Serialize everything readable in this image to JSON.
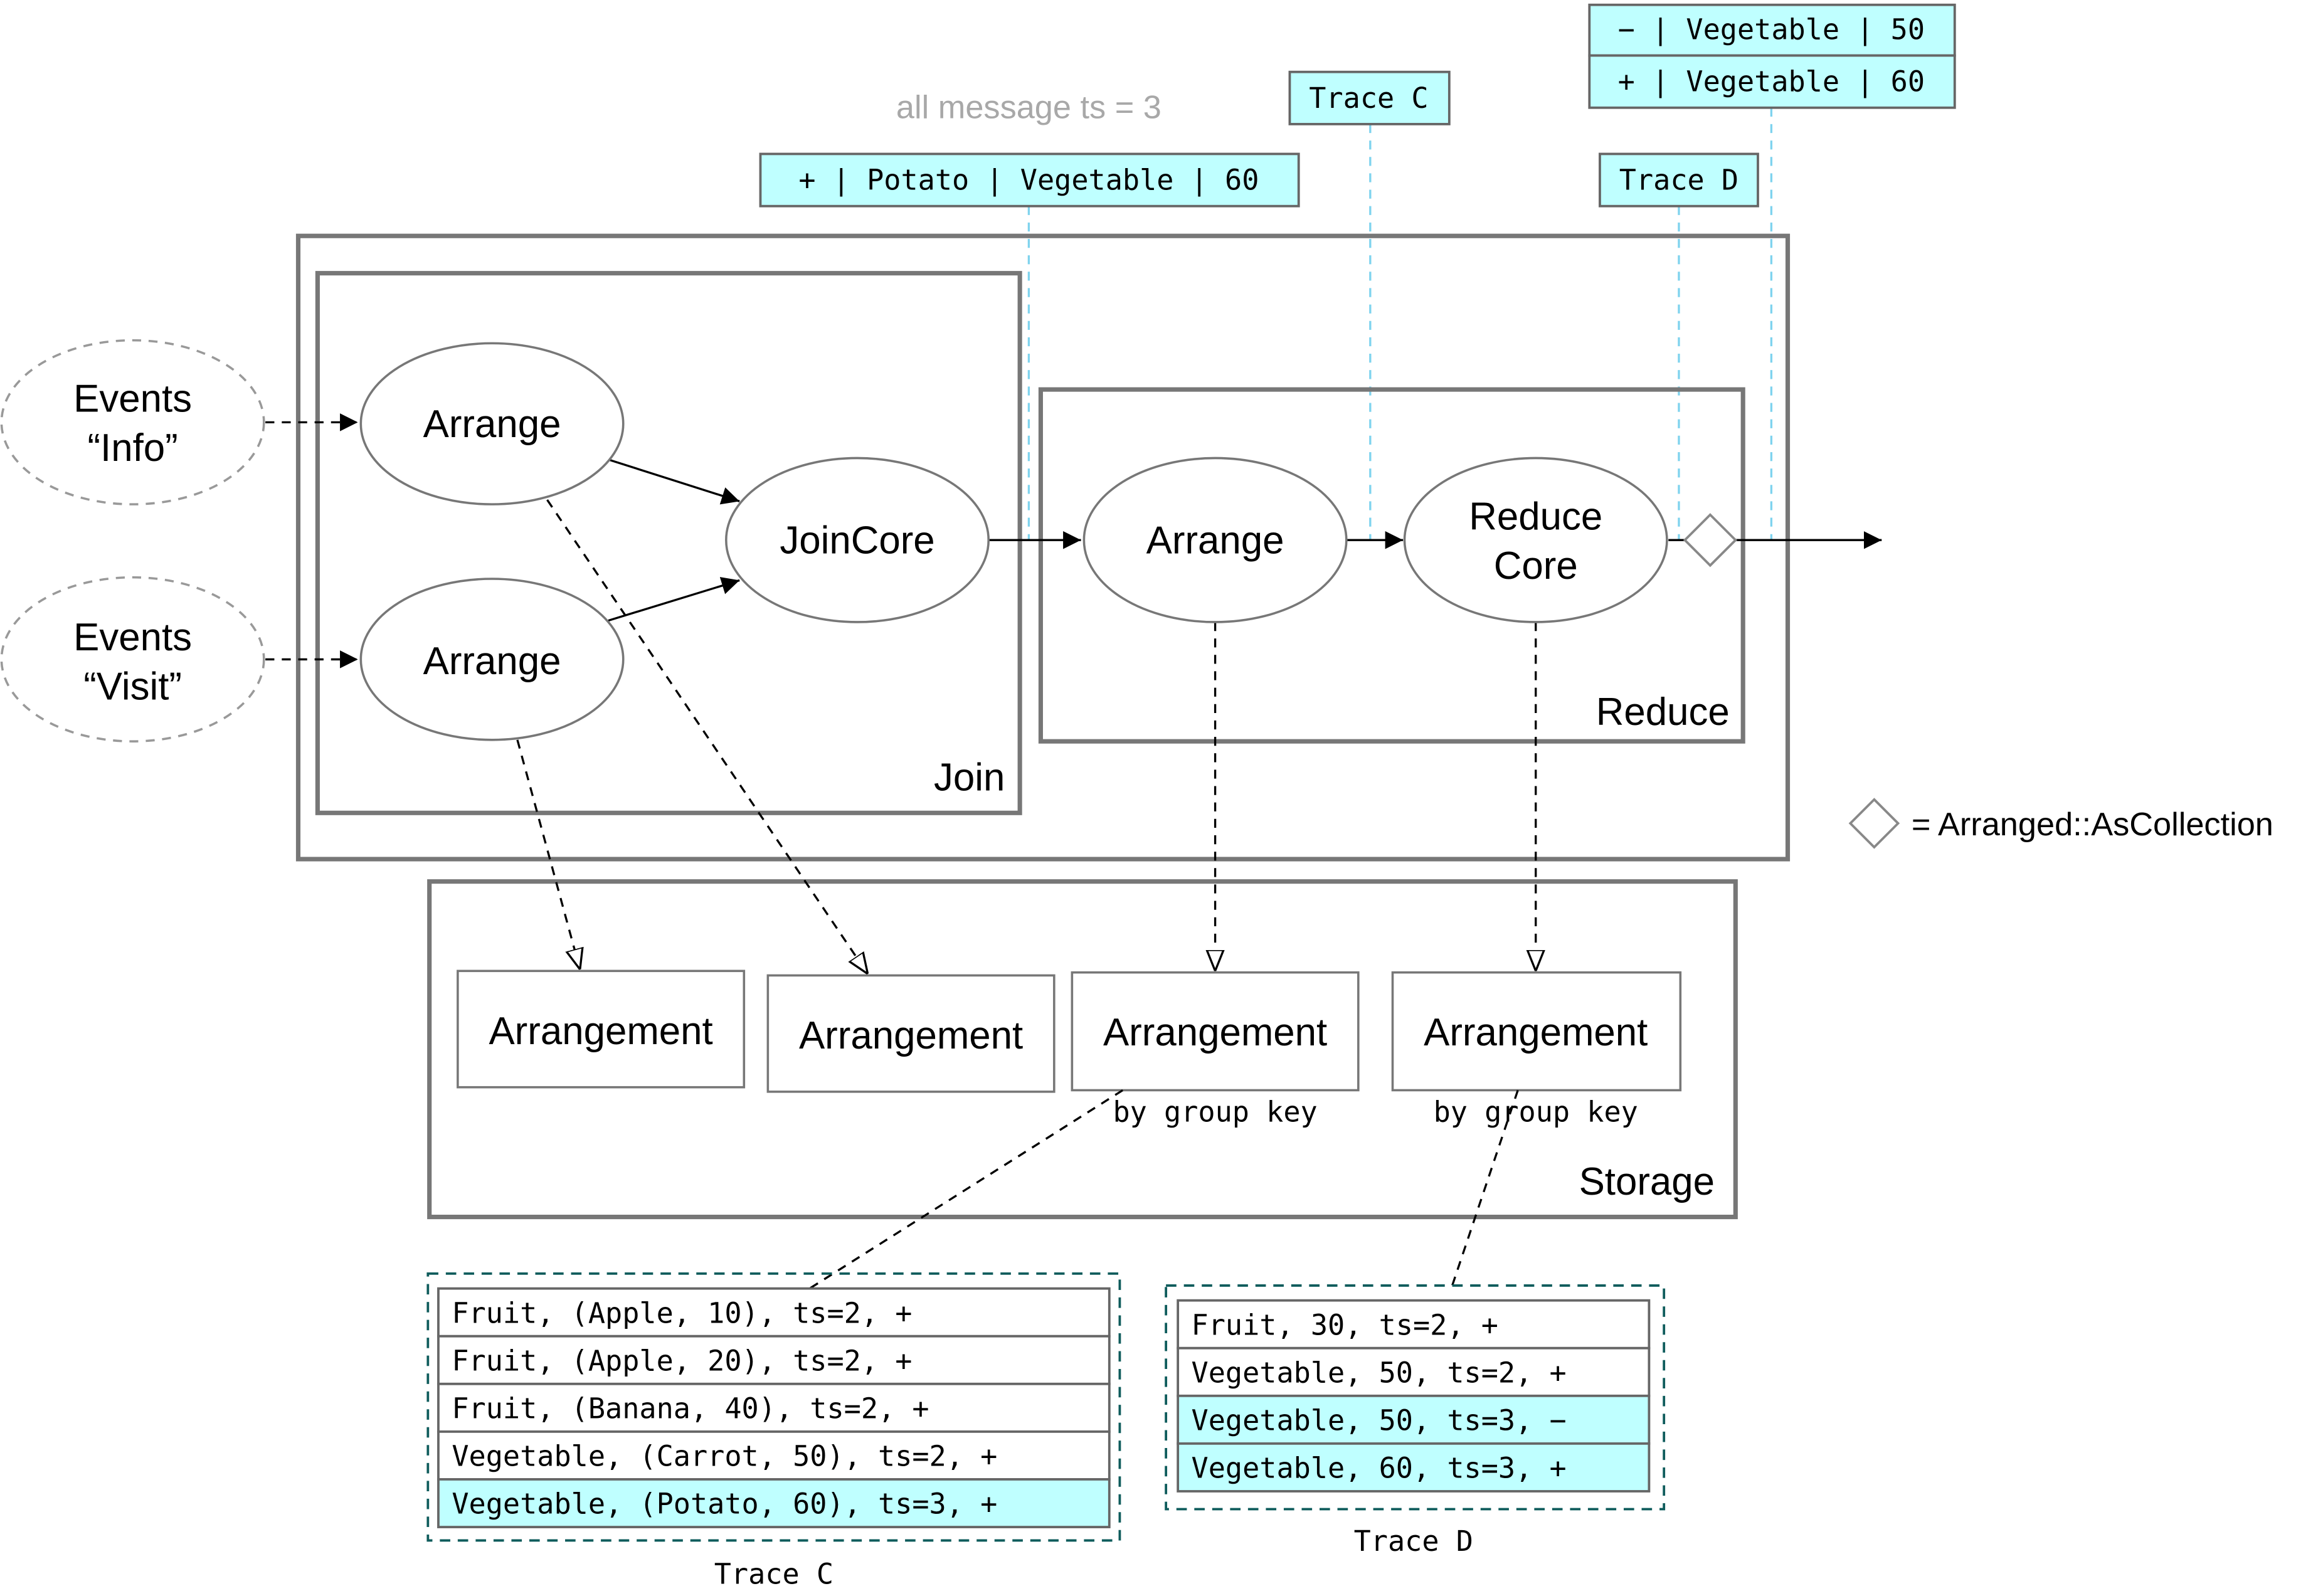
{
  "colors": {
    "highlight": "#bfffff",
    "border": "#777777",
    "probe_line": "#7fd3ee",
    "trace_frame": "#0f5c5c",
    "note_text": "#a8a8a8"
  },
  "annotation": "all message ts = 3",
  "messages": {
    "join_output": "+ | Potato | Vegetable | 60",
    "trace_c_label": "Trace C",
    "trace_d_label": "Trace D",
    "reduce_output": [
      "− | Vegetable | 50",
      "+ | Vegetable | 60"
    ]
  },
  "inputs": [
    {
      "line1": "Events",
      "line2": "“Info”"
    },
    {
      "line1": "Events",
      "line2": "“Visit”"
    }
  ],
  "operators": {
    "arrange_info": "Arrange",
    "arrange_visit": "Arrange",
    "join_core": "JoinCore",
    "arrange_reduce": "Arrange",
    "reduce_core": [
      "Reduce",
      "Core"
    ]
  },
  "groups": {
    "join": "Join",
    "reduce": "Reduce",
    "storage": "Storage"
  },
  "arrangements": [
    {
      "label": "Arrangement",
      "sublabel": ""
    },
    {
      "label": "Arrangement",
      "sublabel": ""
    },
    {
      "label": "Arrangement",
      "sublabel": "by group key"
    },
    {
      "label": "Arrangement",
      "sublabel": "by group key"
    }
  ],
  "legend": {
    "icon": "diamond-icon",
    "text": "= Arranged::AsCollection"
  },
  "traces": [
    {
      "caption": "Trace C",
      "rows": [
        {
          "text": "Fruit, (Apple, 10), ts=2, +",
          "highlighted": false
        },
        {
          "text": "Fruit, (Apple, 20), ts=2, +",
          "highlighted": false
        },
        {
          "text": "Fruit, (Banana, 40), ts=2, +",
          "highlighted": false
        },
        {
          "text": "Vegetable, (Carrot, 50), ts=2, +",
          "highlighted": false
        },
        {
          "text": "Vegetable, (Potato, 60), ts=3, +",
          "highlighted": true
        }
      ]
    },
    {
      "caption": "Trace D",
      "rows": [
        {
          "text": "Fruit, 30, ts=2, +",
          "highlighted": false
        },
        {
          "text": "Vegetable, 50, ts=2, +",
          "highlighted": false
        },
        {
          "text": "Vegetable, 50, ts=3, −",
          "highlighted": true
        },
        {
          "text": "Vegetable, 60, ts=3, +",
          "highlighted": true
        }
      ]
    }
  ]
}
